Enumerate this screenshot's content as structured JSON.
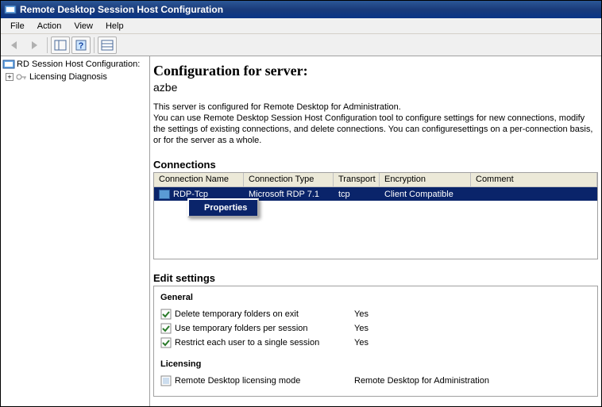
{
  "window": {
    "title": "Remote Desktop Session Host Configuration"
  },
  "menu": {
    "file": "File",
    "action": "Action",
    "view": "View",
    "help": "Help"
  },
  "tree": {
    "root": "RD Session Host Configuration:",
    "child1": "Licensing Diagnosis"
  },
  "main": {
    "heading": "Configuration for server:",
    "server": "azbe",
    "desc1": "This server is configured for Remote Desktop for Administration.",
    "desc2": "You can use Remote Desktop Session Host Configuration tool to configure settings for new connections, modify the settings of existing connections, and delete connections. You can configuresettings on a per-connection basis, or for the server as a whole."
  },
  "connections": {
    "title": "Connections",
    "headers": {
      "name": "Connection Name",
      "type": "Connection Type",
      "transport": "Transport",
      "enc": "Encryption",
      "comment": "Comment"
    },
    "row": {
      "name": "RDP-Tcp",
      "type": "Microsoft RDP 7.1",
      "transport": "tcp",
      "enc": "Client Compatible",
      "comment": ""
    },
    "context": {
      "properties": "Properties"
    }
  },
  "settings": {
    "title": "Edit settings",
    "general": {
      "header": "General",
      "items": [
        {
          "label": "Delete temporary folders on exit",
          "value": "Yes"
        },
        {
          "label": "Use temporary folders per session",
          "value": "Yes"
        },
        {
          "label": "Restrict each user to a single session",
          "value": "Yes"
        }
      ]
    },
    "licensing": {
      "header": "Licensing",
      "items": [
        {
          "label": "Remote Desktop licensing mode",
          "value": "Remote Desktop for Administration"
        }
      ]
    }
  }
}
